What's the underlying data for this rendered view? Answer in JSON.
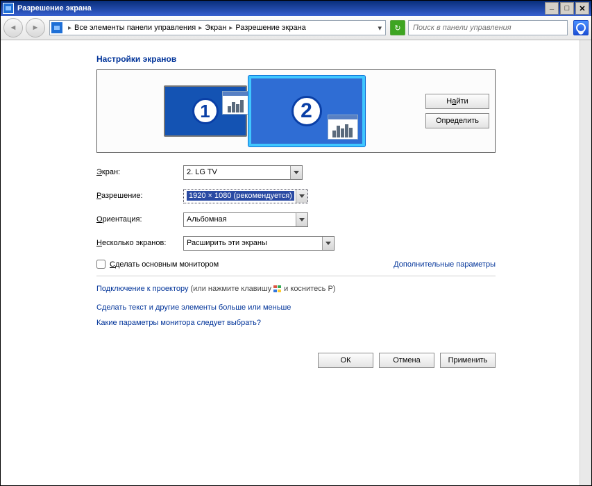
{
  "title": "Разрешение экрана",
  "breadcrumb": {
    "item1": "Все элементы панели управления",
    "item2": "Экран",
    "item3": "Разрешение экрана"
  },
  "search": {
    "placeholder": "Поиск в панели управления"
  },
  "heading": "Настройки экранов",
  "monitors": {
    "num1": "1",
    "num2": "2"
  },
  "previewButtons": {
    "find_pre": "Н",
    "find_u": "а",
    "find_post": "йти",
    "detect": "Определить"
  },
  "labels": {
    "screen_pre": "",
    "screen_u": "Э",
    "screen_post": "кран:",
    "resolution_pre": "",
    "resolution_u": "Р",
    "resolution_post": "азрешение:",
    "orientation_pre": "",
    "orientation_u": "О",
    "orientation_post": "риентация:",
    "multi_pre": "",
    "multi_u": "Н",
    "multi_post": "есколько экранов:"
  },
  "values": {
    "screen": "2. LG TV",
    "resolution": "1920 × 1080 (рекомендуется)",
    "orientation": "Альбомная",
    "multi": "Расширить эти экраны"
  },
  "checkbox": {
    "pre": "",
    "u": "С",
    "post": "делать основным монитором"
  },
  "advanced": "Дополнительные параметры",
  "projector": {
    "link": "Подключение к проектору",
    "text1": " (или нажмите клавишу ",
    "text2": " и коснитесь P)"
  },
  "links": {
    "scale": "Сделать текст и другие элементы больше или меньше",
    "help": "Какие параметры монитора следует выбрать?"
  },
  "actions": {
    "ok": "ОК",
    "cancel": "Отмена",
    "apply": "Применить"
  }
}
